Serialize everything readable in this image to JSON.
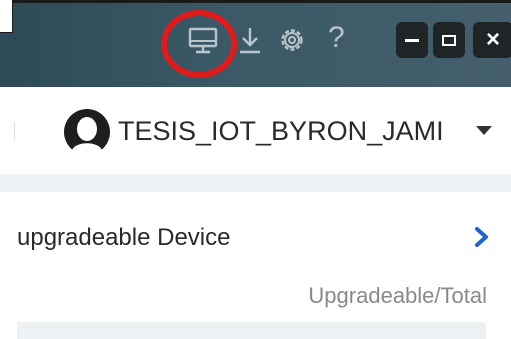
{
  "titlebar": {
    "icons": [
      "monitor-icon",
      "download-icon",
      "gear-icon",
      "help-icon"
    ],
    "help_glyph": "?",
    "window_controls": {
      "minimize": "–",
      "maximize": "□",
      "close": "×"
    },
    "highlight_color": "#e01b1b",
    "background": "#3b5966"
  },
  "user": {
    "name": "TESIS_IOT_BYRON_JAMI",
    "avatar_icon": "user-avatar-icon",
    "dropdown_icon": "caret-down-icon"
  },
  "card": {
    "title": "upgradeable Device",
    "subtitle": "Upgradeable/Total",
    "action_icon": "chevron-right-icon",
    "accent_color": "#1f63d6"
  }
}
